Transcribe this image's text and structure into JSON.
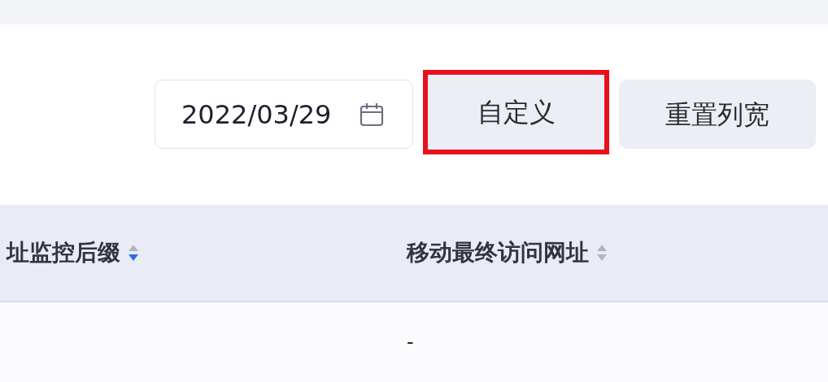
{
  "toolbar": {
    "date_field": {
      "value": "2022/03/29"
    },
    "buttons": [
      {
        "label": "自定义",
        "highlighted": true
      },
      {
        "label": "重置列宽",
        "highlighted": false
      }
    ]
  },
  "table": {
    "columns": [
      {
        "label": "址监控后缀",
        "sorted_descending": true
      },
      {
        "label": "移动最终访问网址",
        "sorted_descending": false
      }
    ],
    "rows": [
      {
        "cells": [
          "",
          "-"
        ]
      }
    ]
  }
}
